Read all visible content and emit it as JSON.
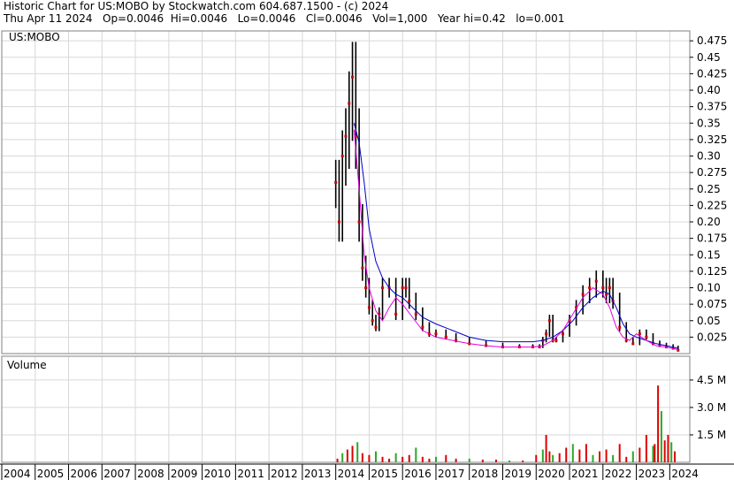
{
  "header": {
    "line1": "Historic Chart for US:MOBO by Stockwatch.com 604.687.1500 - (c) 2024",
    "line2": "Thu Apr 11 2024   Op=0.0046  Hi=0.0046   Lo=0.0046   Cl=0.0046   Vol=1,000   Year hi=0.42   lo=0.001"
  },
  "colors": {
    "background": "#ffffff",
    "grid": "#d8d8d8",
    "frame": "#808080",
    "price_bar": "#000000",
    "down_mark": "#cc0000",
    "ma_short": "#e000e0",
    "ma_long": "#0000cc",
    "vol_up": "#2aa82a",
    "vol_down": "#dd0000"
  },
  "chart_data": [
    {
      "type": "line",
      "title": "US:MOBO",
      "xlabel": "",
      "ylabel": "",
      "x_categories": [
        "2004",
        "2005",
        "2006",
        "2007",
        "2008",
        "2009",
        "2010",
        "2011",
        "2012",
        "2013",
        "2014",
        "2015",
        "2016",
        "2017",
        "2018",
        "2019",
        "2020",
        "2021",
        "2022",
        "2023",
        "2024"
      ],
      "yticks": [
        "0.475",
        "0.45",
        "0.425",
        "0.40",
        "0.375",
        "0.35",
        "0.325",
        "0.30",
        "0.275",
        "0.25",
        "0.225",
        "0.20",
        "0.175",
        "0.15",
        "0.125",
        "0.10",
        "0.075",
        "0.05",
        "0.025"
      ],
      "ylim": [
        0,
        0.49
      ],
      "grid": true,
      "series": [
        {
          "label": "price",
          "x": [
            2014.0,
            2014.1,
            2014.2,
            2014.3,
            2014.4,
            2014.5,
            2014.6,
            2014.7,
            2014.8,
            2014.9,
            2015.0,
            2015.1,
            2015.2,
            2015.3,
            2015.4,
            2015.6,
            2015.8,
            2016.0,
            2016.1,
            2016.2,
            2016.4,
            2016.6,
            2016.8,
            2017.0,
            2017.3,
            2017.6,
            2018.0,
            2018.5,
            2019.0,
            2019.5,
            2019.9,
            2020.1,
            2020.2,
            2020.3,
            2020.4,
            2020.5,
            2020.6,
            2020.8,
            2021.0,
            2021.2,
            2021.4,
            2021.6,
            2021.8,
            2022.0,
            2022.1,
            2022.2,
            2022.3,
            2022.5,
            2022.7,
            2022.9,
            2023.1,
            2023.3,
            2023.5,
            2023.7,
            2023.9,
            2024.1,
            2024.25
          ],
          "y": [
            0.26,
            0.2,
            0.3,
            0.33,
            0.38,
            0.42,
            0.33,
            0.2,
            0.13,
            0.1,
            0.07,
            0.05,
            0.04,
            0.06,
            0.1,
            0.1,
            0.06,
            0.1,
            0.1,
            0.08,
            0.06,
            0.04,
            0.03,
            0.03,
            0.025,
            0.02,
            0.015,
            0.012,
            0.01,
            0.01,
            0.01,
            0.01,
            0.02,
            0.03,
            0.05,
            0.02,
            0.02,
            0.03,
            0.05,
            0.07,
            0.09,
            0.1,
            0.11,
            0.1,
            0.09,
            0.1,
            0.08,
            0.04,
            0.02,
            0.015,
            0.03,
            0.025,
            0.015,
            0.012,
            0.01,
            0.008,
            0.005
          ]
        },
        {
          "label": "ma_long",
          "x": [
            2014.55,
            2014.7,
            2014.85,
            2015.0,
            2015.2,
            2015.4,
            2015.6,
            2015.8,
            2016.0,
            2016.3,
            2016.6,
            2017.0,
            2017.5,
            2018.0,
            2018.5,
            2019.0,
            2019.5,
            2019.9,
            2020.2,
            2020.5,
            2020.8,
            2021.1,
            2021.4,
            2021.7,
            2022.0,
            2022.2,
            2022.4,
            2022.6,
            2022.8,
            2023.0,
            2023.3,
            2023.6,
            2023.9,
            2024.25
          ],
          "y": [
            0.35,
            0.32,
            0.26,
            0.19,
            0.14,
            0.115,
            0.1,
            0.09,
            0.085,
            0.07,
            0.055,
            0.045,
            0.035,
            0.025,
            0.02,
            0.018,
            0.018,
            0.018,
            0.02,
            0.025,
            0.035,
            0.05,
            0.07,
            0.085,
            0.095,
            0.09,
            0.07,
            0.045,
            0.03,
            0.025,
            0.02,
            0.015,
            0.012,
            0.008
          ]
        },
        {
          "label": "ma_short",
          "x": [
            2014.55,
            2014.7,
            2014.85,
            2015.0,
            2015.2,
            2015.4,
            2015.6,
            2015.8,
            2016.0,
            2016.3,
            2016.6,
            2017.0,
            2017.5,
            2018.0,
            2018.5,
            2019.0,
            2019.5,
            2019.9,
            2020.2,
            2020.5,
            2020.8,
            2021.1,
            2021.4,
            2021.7,
            2022.0,
            2022.2,
            2022.4,
            2022.6,
            2022.8,
            2023.0,
            2023.3,
            2023.6,
            2023.9,
            2024.25
          ],
          "y": [
            0.34,
            0.25,
            0.15,
            0.1,
            0.065,
            0.05,
            0.07,
            0.085,
            0.075,
            0.055,
            0.035,
            0.025,
            0.02,
            0.015,
            0.012,
            0.01,
            0.01,
            0.01,
            0.012,
            0.02,
            0.035,
            0.06,
            0.085,
            0.1,
            0.09,
            0.07,
            0.04,
            0.025,
            0.02,
            0.03,
            0.02,
            0.012,
            0.01,
            0.006
          ]
        }
      ]
    },
    {
      "type": "bar",
      "title": "Volume",
      "xlabel": "",
      "ylabel": "",
      "yticks": [
        "4.5 M",
        "3.0 M",
        "1.5 M"
      ],
      "ylim": [
        0,
        5800000
      ],
      "grid": true,
      "series": [
        {
          "label": "volume",
          "x": [
            2014.05,
            2014.2,
            2014.35,
            2014.5,
            2014.65,
            2014.8,
            2015.0,
            2015.2,
            2015.4,
            2015.6,
            2015.8,
            2016.0,
            2016.2,
            2016.4,
            2016.6,
            2016.8,
            2017.0,
            2017.3,
            2017.6,
            2018.0,
            2018.4,
            2018.8,
            2019.2,
            2019.6,
            2020.0,
            2020.2,
            2020.3,
            2020.4,
            2020.5,
            2020.7,
            2020.9,
            2021.1,
            2021.3,
            2021.5,
            2021.7,
            2021.9,
            2022.1,
            2022.3,
            2022.5,
            2022.7,
            2022.9,
            2023.1,
            2023.3,
            2023.5,
            2023.55,
            2023.65,
            2023.75,
            2023.85,
            2023.95,
            2024.05,
            2024.15
          ],
          "y": [
            200000,
            500000,
            700000,
            900000,
            1100000,
            500000,
            400000,
            600000,
            300000,
            200000,
            500000,
            300000,
            400000,
            800000,
            300000,
            200000,
            300000,
            400000,
            200000,
            200000,
            150000,
            150000,
            100000,
            100000,
            400000,
            700000,
            1500000,
            600000,
            400000,
            500000,
            800000,
            1000000,
            700000,
            1000000,
            400000,
            600000,
            700000,
            400000,
            1000000,
            300000,
            600000,
            800000,
            1500000,
            900000,
            1000000,
            4200000,
            2800000,
            1200000,
            1500000,
            1100000,
            600000
          ]
        }
      ]
    }
  ]
}
